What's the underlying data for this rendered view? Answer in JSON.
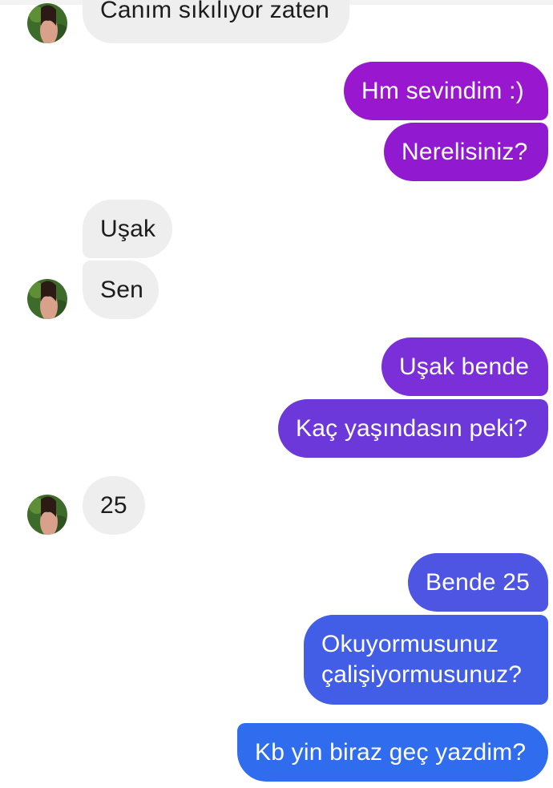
{
  "conversation": {
    "messages": [
      {
        "id": "m0",
        "from": "contact",
        "text": "Canım sıkılıyor zaten"
      },
      {
        "id": "m1",
        "from": "me",
        "text": "Hm sevindim :)"
      },
      {
        "id": "m2",
        "from": "me",
        "text": "Nerelisiniz?"
      },
      {
        "id": "m3",
        "from": "contact",
        "text": "Uşak"
      },
      {
        "id": "m4",
        "from": "contact",
        "text": "Sen"
      },
      {
        "id": "m5",
        "from": "me",
        "text": "Uşak bende"
      },
      {
        "id": "m6",
        "from": "me",
        "text": "Kaç yaşındasın peki?"
      },
      {
        "id": "m7",
        "from": "contact",
        "text": "25"
      },
      {
        "id": "m8",
        "from": "me",
        "text": "Bende 25"
      },
      {
        "id": "m9",
        "from": "me",
        "text": "Okuyormusunuz çalişiyormusunuz?"
      },
      {
        "id": "m10",
        "from": "me",
        "text": "Kb yin biraz geç yazdim?"
      }
    ]
  },
  "colors": {
    "incoming_bubble": "#eeeeef",
    "outgoing_top": "#9a17cf",
    "outgoing_bottom": "#2d6ff0"
  }
}
